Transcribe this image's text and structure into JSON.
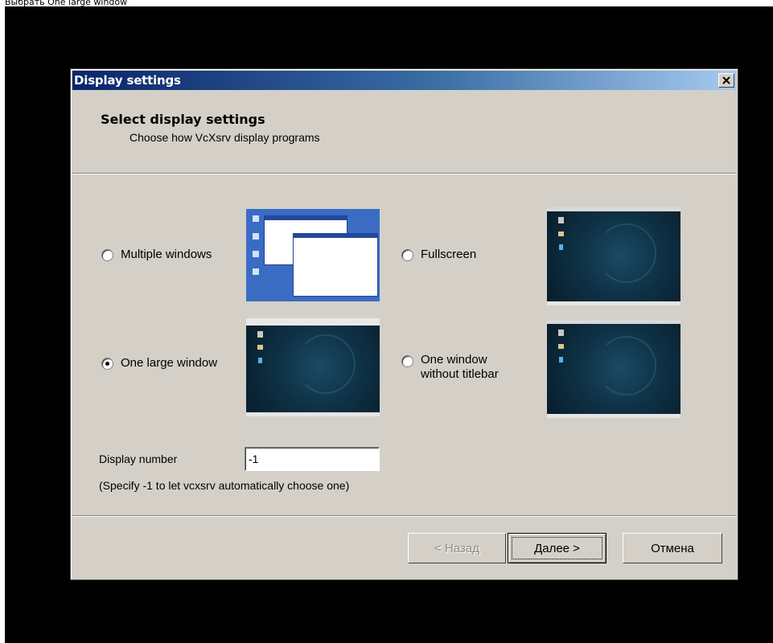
{
  "caption": "Выбрать One large window",
  "dialog": {
    "title": "Display settings",
    "close_glyph": "✕",
    "header_title": "Select display settings",
    "header_subtitle": "Choose how VcXsrv display programs"
  },
  "options": [
    {
      "label": "Multiple windows",
      "checked": false,
      "preview": "windows-desktop-preview"
    },
    {
      "label": "Fullscreen",
      "checked": false,
      "preview": "debian-desktop-preview"
    },
    {
      "label": "One large window",
      "checked": true,
      "preview": "debian-desktop-preview"
    },
    {
      "label_line1": "One window",
      "label_line2": "without titlebar",
      "checked": false,
      "preview": "debian-desktop-preview"
    }
  ],
  "display_number": {
    "label": "Display number",
    "value": "-1",
    "hint": "(Specify -1 to let vcxsrv automatically choose one)"
  },
  "buttons": {
    "back": "< Назад",
    "next": "Далее >",
    "cancel": "Отмена"
  },
  "colors": {
    "dialog_bg": "#d4d0c8",
    "titlebar_start": "#0a246a",
    "titlebar_end": "#a6caf0",
    "outer_bg": "#000000"
  }
}
